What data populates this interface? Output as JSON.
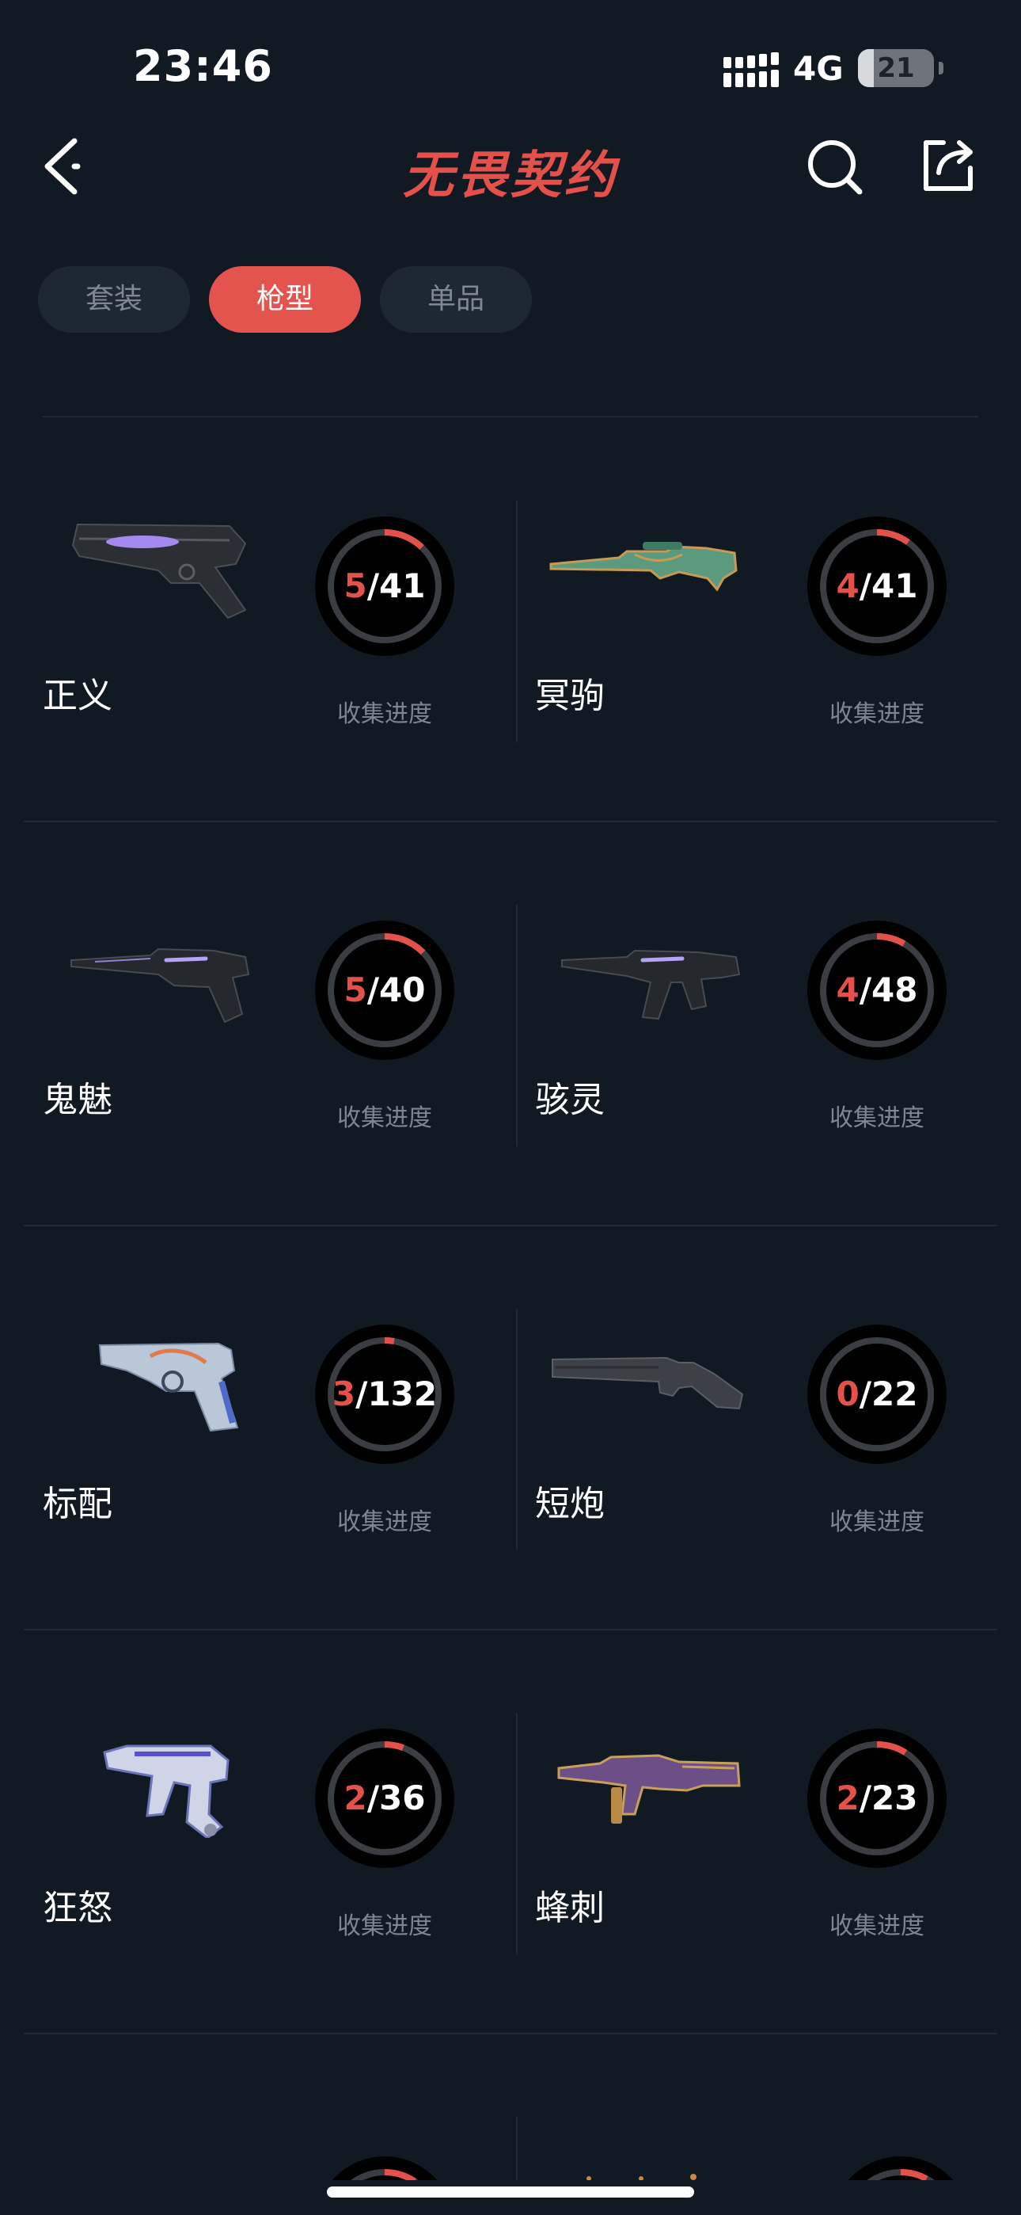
{
  "status": {
    "time": "23:46",
    "network": "4G",
    "battery": "21",
    "battery_level": 0.21
  },
  "header": {
    "title": "无畏契约"
  },
  "tabs": [
    {
      "label": "套装",
      "active": false
    },
    {
      "label": "枪型",
      "active": true
    },
    {
      "label": "单品",
      "active": false
    }
  ],
  "progress_caption": "收集进度",
  "weapons": [
    {
      "name": "正义",
      "have": "5",
      "total": "/41",
      "gun_icon": "revolver-icon"
    },
    {
      "name": "冥驹",
      "have": "4",
      "total": "/41",
      "gun_icon": "sniper-rifle-icon"
    },
    {
      "name": "鬼魅",
      "have": "5",
      "total": "/40",
      "gun_icon": "pistol-icon"
    },
    {
      "name": "骇灵",
      "have": "4",
      "total": "/48",
      "gun_icon": "smg-icon"
    },
    {
      "name": "标配",
      "have": "3",
      "total": "/132",
      "gun_icon": "classic-pistol-icon"
    },
    {
      "name": "短炮",
      "have": "0",
      "total": "/22",
      "gun_icon": "shotgun-icon"
    },
    {
      "name": "狂怒",
      "have": "2",
      "total": "/36",
      "gun_icon": "frenzy-pistol-icon"
    },
    {
      "name": "蜂刺",
      "have": "2",
      "total": "/23",
      "gun_icon": "stinger-smg-icon"
    }
  ],
  "colors": {
    "accent": "#e4504a",
    "background": "#111923",
    "ring_track": "#3a3d42"
  }
}
